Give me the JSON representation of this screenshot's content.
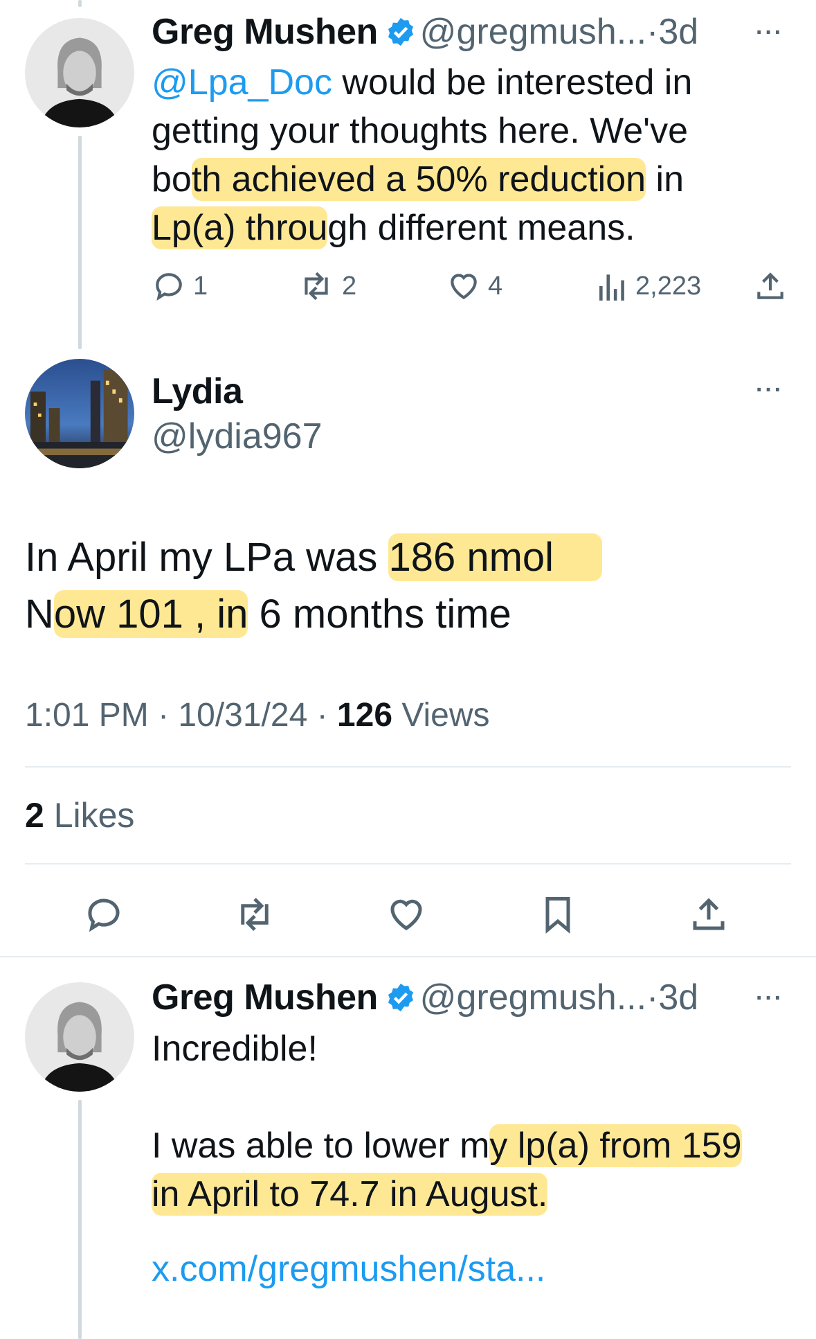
{
  "colors": {
    "accent": "#1d9bf0",
    "muted": "#536471",
    "highlight": "#ffd63c"
  },
  "reply_top": {
    "author_name": "Greg Mushen",
    "handle": "@gregmush...",
    "separator": "·",
    "time": "3d",
    "more": "···",
    "mention": "@Lpa_Doc",
    "text_1": " would be interested in getting your thoughts here. We've bo",
    "text_hl": "th achieved a 50% reduction",
    "text_2": " in ",
    "text_hl2": "Lp(a) throu",
    "text_3": "gh different means.",
    "actions": {
      "replies": "1",
      "reposts": "2",
      "likes": "4",
      "views": "2,223"
    }
  },
  "main_tweet": {
    "author_name": "Lydia",
    "handle": "@lydia967",
    "more": "···",
    "line1_pre": "In April my LPa was ",
    "line1_hl": "186 nmol",
    "line2_pre": "N",
    "line2_hl": "ow 101 , in",
    "line2_post": " 6 months time",
    "time": "1:01 PM",
    "date": "10/31/24",
    "views_count": "126",
    "views_label": " Views",
    "likes_count": "2",
    "likes_label": " Likes",
    "sep": " · "
  },
  "reply_bottom": {
    "author_name": "Greg Mushen",
    "handle": "@gregmush...",
    "separator": "·",
    "time": "3d",
    "more": "···",
    "line1": "Incredible!",
    "line2_pre": "I was able to lower m",
    "line2_hl": "y lp(a) from 159 in April to 74.7 in August.",
    "link": "x.com/gregmushen/sta..."
  }
}
